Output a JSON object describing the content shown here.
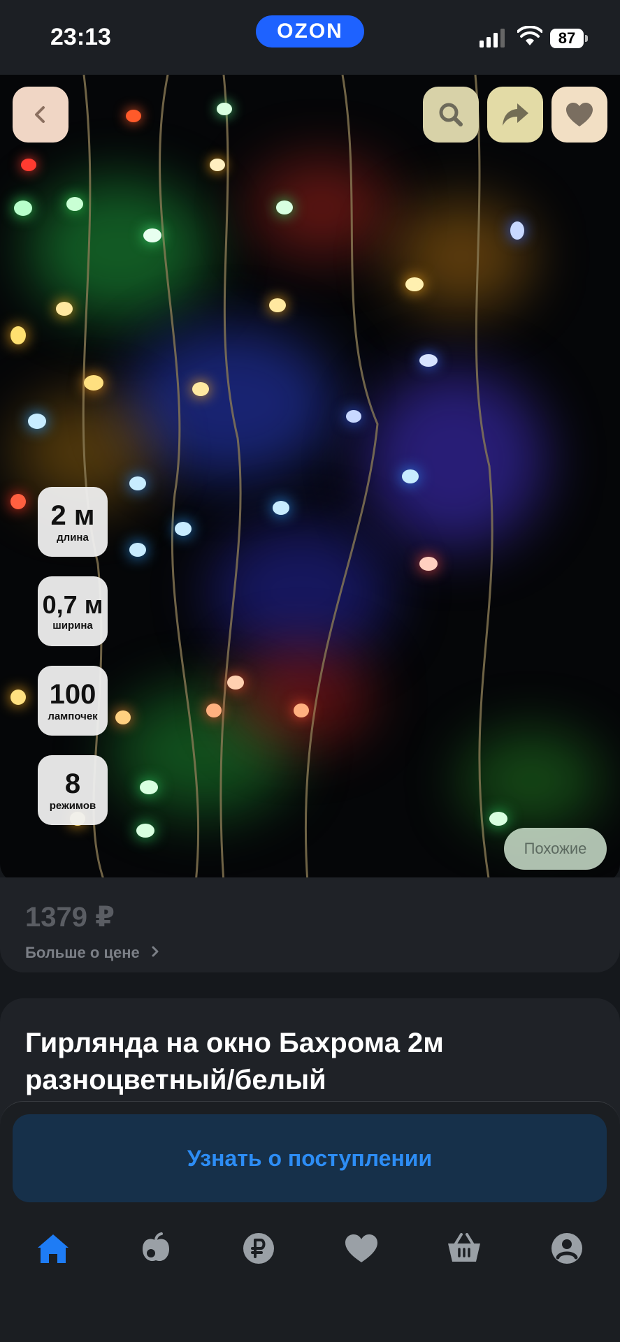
{
  "status": {
    "time": "23:13",
    "brand": "OZON",
    "battery": "87"
  },
  "product": {
    "price": "1379 ₽",
    "price_more": "Больше о цене",
    "title": "Гирлянда на окно Бахрома 2м разноцветный/белый",
    "similar_label": "Похожие",
    "specs": [
      {
        "value": "2 м",
        "label": "длина"
      },
      {
        "value": "0,7 м",
        "label": "ширина"
      },
      {
        "value": "100",
        "label": "лампочек"
      },
      {
        "value": "8",
        "label": "режимов"
      }
    ]
  },
  "actions": {
    "notify_label": "Узнать о поступлении"
  },
  "tabbar": {
    "items": [
      "home-icon",
      "catalog-apple-icon",
      "ruble-icon",
      "favorites-heart-icon",
      "basket-icon",
      "profile-icon"
    ],
    "active_color": "#1e7cf5",
    "inactive_color": "#9aa0a6"
  },
  "colors": {
    "accent": "#1e62ff",
    "notify_text": "#2d8df5"
  }
}
